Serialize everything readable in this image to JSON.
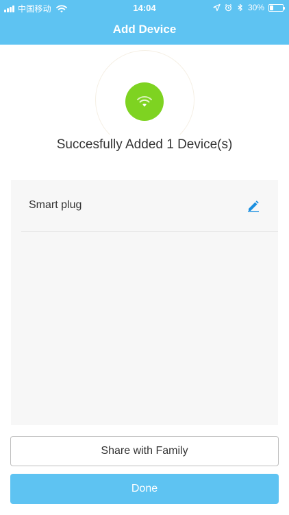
{
  "status_bar": {
    "carrier": "中国移动",
    "time": "14:04",
    "battery": "30%",
    "battery_level": 0.3,
    "icons": [
      "signal-icon",
      "wifi-icon",
      "location-icon",
      "alarm-icon",
      "bluetooth-icon",
      "battery-icon"
    ]
  },
  "nav": {
    "title": "Add Device"
  },
  "success": {
    "message": "Succesfully Added 1 Device(s)",
    "icon": "wifi-icon",
    "badge_color": "#7ed321"
  },
  "devices": [
    {
      "name": "Smart plug",
      "edit_icon": "pencil-icon"
    }
  ],
  "actions": {
    "share_label": "Share with Family",
    "done_label": "Done"
  },
  "colors": {
    "primary": "#5ec3f2",
    "edit_icon": "#1a8fe0",
    "panel_bg": "#f7f7f7"
  }
}
